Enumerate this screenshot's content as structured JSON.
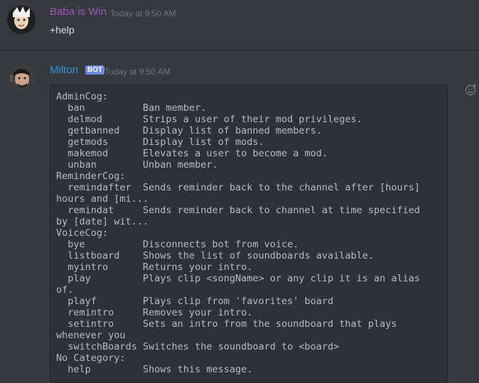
{
  "messages": [
    {
      "username": "Baba is Win",
      "username_color": "#9b59b6",
      "timestamp": "Today at 9:50 AM",
      "content": "+help"
    },
    {
      "username": "Milton",
      "username_color": "#3498db",
      "bot_badge": "BOT",
      "timestamp": "Today at 9:50 AM",
      "code_block": "AdminCog:\n  ban          Ban member.\n  delmod       Strips a user of their mod privileges.\n  getbanned    Display list of banned members.\n  getmods      Display list of mods.\n  makemod      Elevates a user to become a mod.\n  unban        Unban member.\nReminderCog:\n  remindafter  Sends reminder back to the channel after [hours]\nhours and [mi...\n  remindat     Sends reminder back to channel at time specified\nby [date] wit...\nVoiceCog:\n  bye          Disconnects bot from voice.\n  listboard    Shows the list of soundboards available.\n  myintro      Returns your intro.\n  play         Plays clip <songName> or any clip it is an alias\nof.\n  playf        Plays clip from 'favorites' board\n  remintro     Removes your intro.\n  setintro     Sets an intro from the soundboard that plays\nwhenever you\n  switchBoards Switches the soundboard to <board>\nNo Category:\n  help         Shows this message."
    }
  ],
  "icons": {
    "add_reaction": "add-reaction-icon"
  },
  "colors": {
    "background": "#36393f",
    "code_background": "#2f3136",
    "bot_badge": "#7289da",
    "timestamp": "#72767d",
    "text": "#dcddde"
  }
}
